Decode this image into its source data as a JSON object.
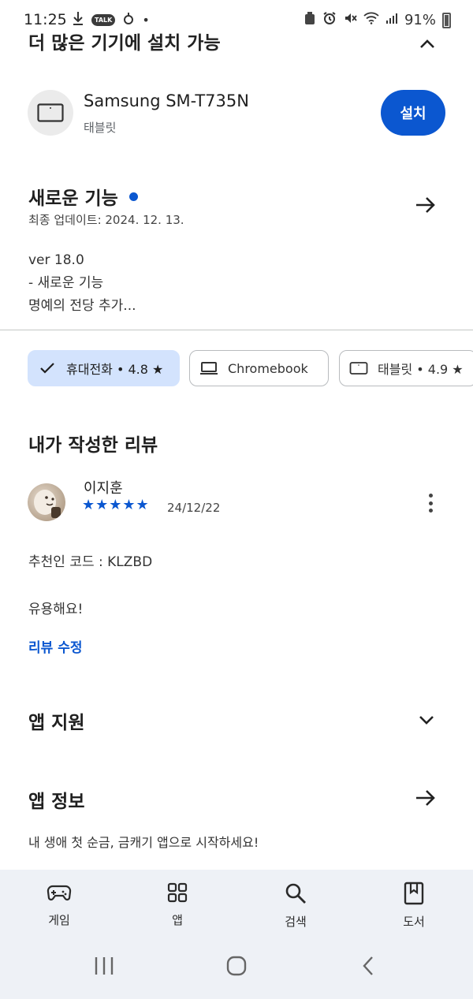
{
  "status_bar": {
    "time": "11:25",
    "talk_badge": "TALK",
    "battery": "91%"
  },
  "cut_header": {
    "title": "더 많은 기기에 설치 가능"
  },
  "device": {
    "name": "Samsung SM-T735N",
    "type": "태블릿",
    "install_label": "설치"
  },
  "whats_new": {
    "title": "새로운 기능",
    "updated": "최종 업데이트: 2024. 12. 13.",
    "lines": [
      "ver 18.0",
      "- 새로운 기능",
      "명예의 전당 추가..."
    ]
  },
  "chips": [
    {
      "label": "휴대전화 • 4.8 ★",
      "selected": true
    },
    {
      "label": "Chromebook",
      "selected": false
    },
    {
      "label": "태블릿 • 4.9 ★",
      "selected": false
    }
  ],
  "my_review": {
    "title": "내가 작성한 리뷰",
    "reviewer": "이지훈",
    "stars": "★★★★★",
    "rating": 5,
    "date": "24/12/22",
    "text_line1": "추천인 코드 : KLZBD",
    "text_line2": "유용해요!",
    "edit_label": "리뷰 수정"
  },
  "app_support": {
    "title": "앱 지원"
  },
  "app_info": {
    "title": "앱 정보",
    "description": "내 생애 첫 순금, 금캐기 앱으로 시작하세요!"
  },
  "bottom_nav": [
    {
      "label": "게임",
      "icon": "gamepad-icon"
    },
    {
      "label": "앱",
      "icon": "apps-grid-icon"
    },
    {
      "label": "검색",
      "icon": "search-icon"
    },
    {
      "label": "도서",
      "icon": "book-icon"
    }
  ],
  "colors": {
    "accent": "#0b57d0",
    "chip_selected_bg": "#d3e3fd",
    "nav_bg": "#eef1f6"
  }
}
